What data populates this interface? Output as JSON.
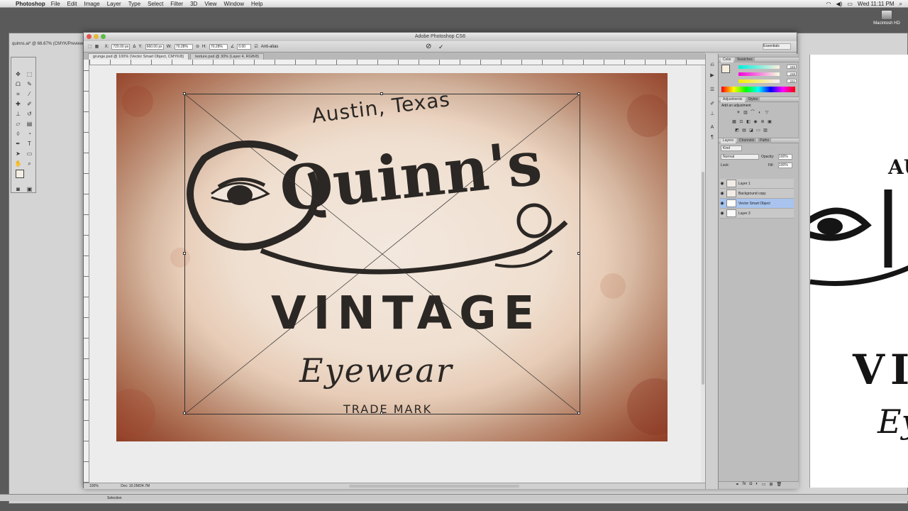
{
  "menubar": {
    "app": "Photoshop",
    "items": [
      "File",
      "Edit",
      "Image",
      "Layer",
      "Type",
      "Select",
      "Filter",
      "3D",
      "View",
      "Window",
      "Help"
    ],
    "clock": "Wed 11:11 PM"
  },
  "desktop": {
    "hd_label": "Macintosh HD"
  },
  "window": {
    "title": "Adobe Photoshop CS6"
  },
  "options": {
    "x_value": "720.00 px",
    "y_value": "660.00 px",
    "w_value": "70.28%",
    "h_value": "70.28%",
    "angle_value": "0.00",
    "antialias_label": "Anti-alias",
    "essentials": "Essentials"
  },
  "doc_tabs": [
    {
      "label": "grunge.psd @ 100% (Vector Smart Object, CMYK/8)"
    },
    {
      "label": "texture.psd @ 30% (Layer 4, RGB/8)"
    }
  ],
  "back_tab": "quinns.ai* @ 66.67% (CMYK/Preview)",
  "artwork": {
    "line1": "Austin, Texas",
    "line2": "Quinn's",
    "line3": "VINTAGE",
    "line4": "Eyewear",
    "line5": "TRADE MARK"
  },
  "backcanvas": {
    "t1": "AU",
    "t2": "VII",
    "t3": "Ey"
  },
  "status": {
    "zoom": "100%",
    "doc": "Doc: 10.2M/24.7M"
  },
  "panels": {
    "color_tabs": [
      "Color",
      "Swatches"
    ],
    "color_values": [
      "245",
      "238",
      "221"
    ],
    "adjust_tabs": [
      "Adjustments",
      "Styles"
    ],
    "adjust_hint": "Add an adjustment",
    "layers_tabs": [
      "Layers",
      "Channels",
      "Paths"
    ],
    "blend_mode": "Normal",
    "opacity_label": "Opacity:",
    "opacity_value": "100%",
    "lock_label": "Lock:",
    "fill_label": "Fill:",
    "fill_value": "100%",
    "kind": "Kind",
    "layers": [
      {
        "name": "Layer 1",
        "selected": false
      },
      {
        "name": "Background copy",
        "selected": false
      },
      {
        "name": "Vector Smart Object",
        "selected": true
      },
      {
        "name": "Layer 3",
        "selected": false
      }
    ]
  },
  "bottom": {
    "selection": "Selection"
  }
}
